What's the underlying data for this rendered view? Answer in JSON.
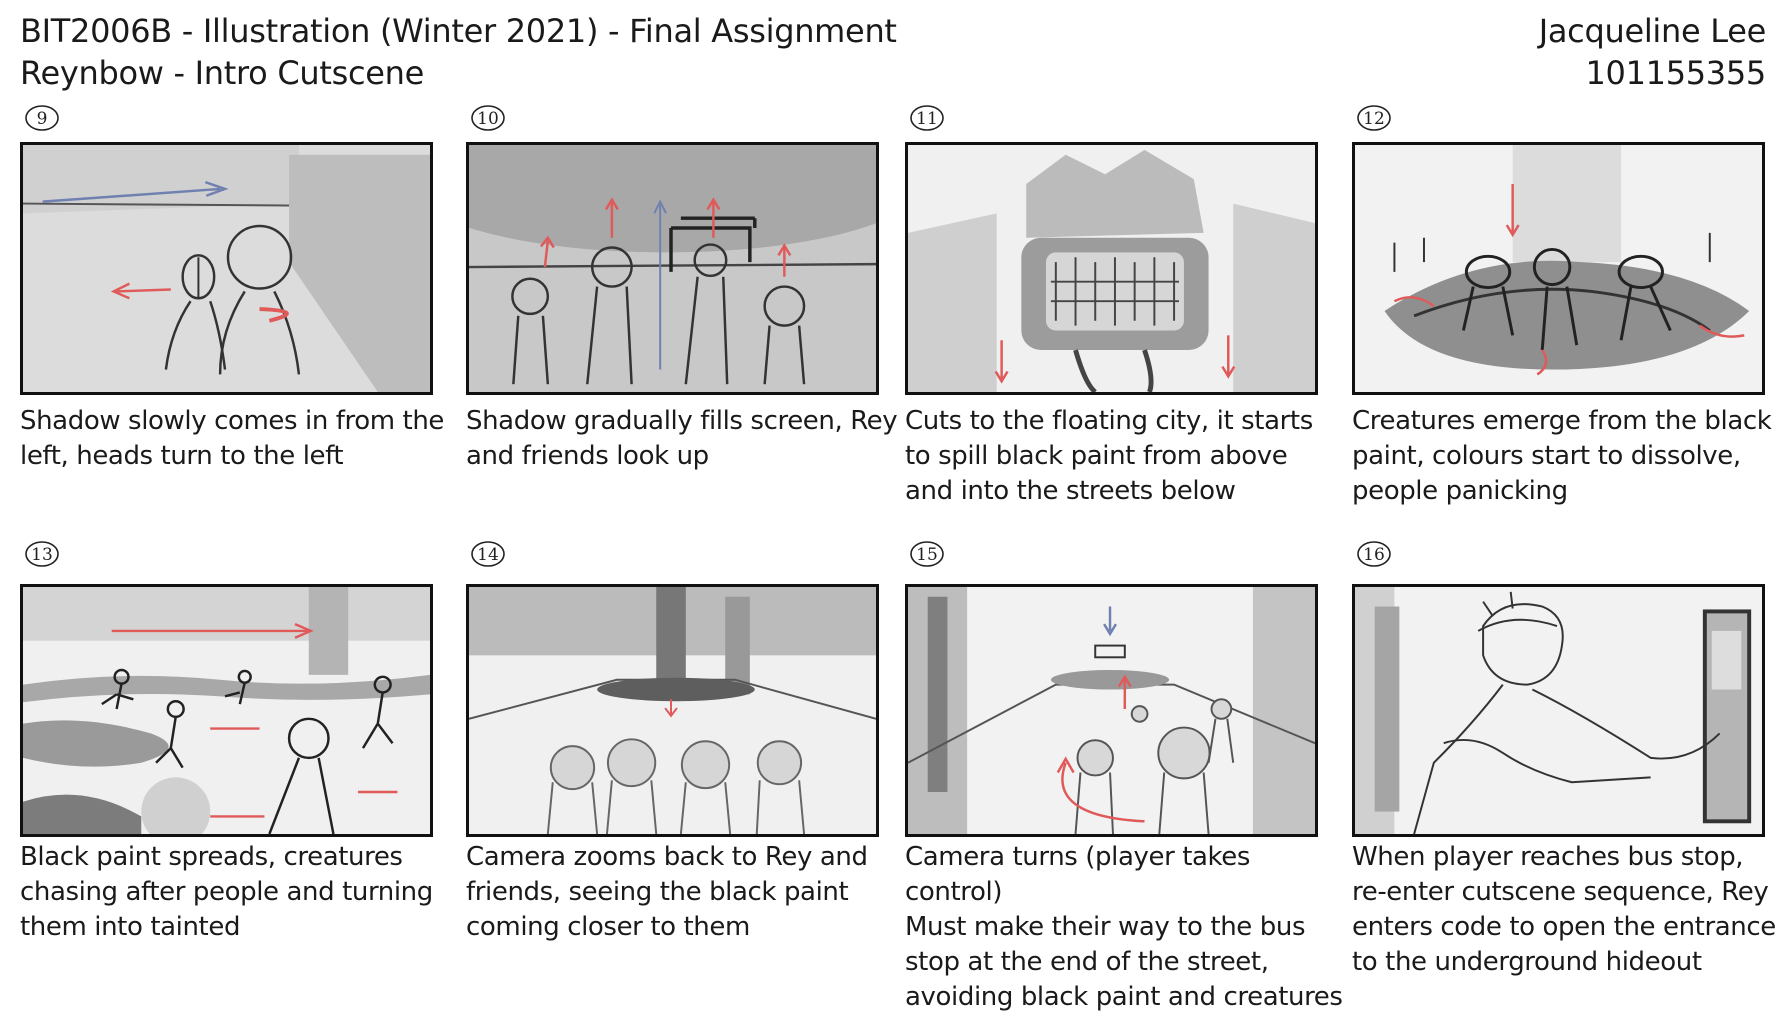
{
  "header": {
    "course_line": "BIT2006B - Illustration (Winter 2021) - Final Assignment",
    "project_line": "Reynbow - Intro Cutscene",
    "author": "Jacqueline Lee",
    "student_id": "101155355"
  },
  "panels": [
    {
      "number": "9",
      "caption": "Shadow slowly comes in from the\nleft, heads turn to the left"
    },
    {
      "number": "10",
      "caption": "Shadow gradually fills screen, Rey\nand friends look up"
    },
    {
      "number": "11",
      "caption": "Cuts to the floating city, it starts\nto spill black paint  from above\nand into the streets below"
    },
    {
      "number": "12",
      "caption": "Creatures emerge from the black\npaint, colours start to dissolve,\npeople panicking"
    },
    {
      "number": "13",
      "caption": "Black paint spreads, creatures\nchasing after people and turning\nthem into tainted"
    },
    {
      "number": "14",
      "caption": "Camera zooms back to Rey and\nfriends, seeing the black paint\ncoming closer to them"
    },
    {
      "number": "15",
      "caption": "Camera turns (player takes control)\nMust make their way to the bus\nstop at the end of the street,\navoiding black paint and creatures"
    },
    {
      "number": "16",
      "caption": "When player reaches bus stop,\nre-enter cutscene sequence, Rey\nenters code to open the entrance\nto the underground hideout"
    }
  ],
  "colors": {
    "frame_border": "#111111",
    "arrow_red": "#e05a5a",
    "arrow_blue": "#7080b0"
  }
}
